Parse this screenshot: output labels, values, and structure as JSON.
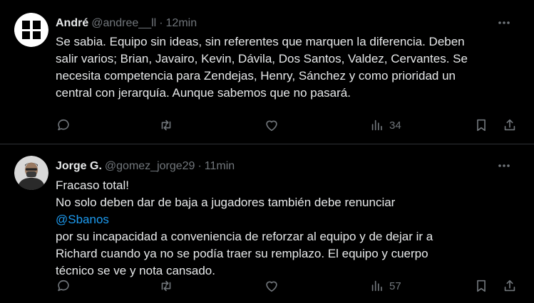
{
  "tweets": [
    {
      "display_name": "André",
      "handle": "@andree__ll",
      "separator": "·",
      "time": "12min",
      "avatar_icon": "black-white-split-logo",
      "text_lines": [
        "Se sabia. Equipo sin ideas, sin referentes que marquen la diferencia. Deben",
        "salir varios; Brian, Javairo, Kevin, Dávila, Dos Santos, Valdez, Cervantes. Se",
        "necesita competencia para Zendejas, Henry, Sánchez y como prioridad un",
        "central con jerarquía. Aunque sabemos que no pasará."
      ],
      "views": "34"
    },
    {
      "display_name": "Jorge G.",
      "handle": "@gomez_jorge29",
      "separator": "·",
      "time": "11min",
      "avatar_icon": "person-photo",
      "line_1": "Fracaso total!",
      "line_2": "No solo deben dar de baja a jugadores también debe renunciar",
      "mention": "@Sbanos",
      "line_3_rest": "por su incapacidad a conveniencia de reforzar al equipo y de dejar ir a",
      "line_4": "Richard cuando ya no se podía traer su remplazo. El equipo y cuerpo",
      "line_5": "técnico se ve y nota cansado.",
      "views": "57"
    }
  ],
  "colors": {
    "background": "#000000",
    "text": "#e7e9ea",
    "muted": "#71767b",
    "link": "#1d9bf0",
    "divider": "#2f3336"
  }
}
